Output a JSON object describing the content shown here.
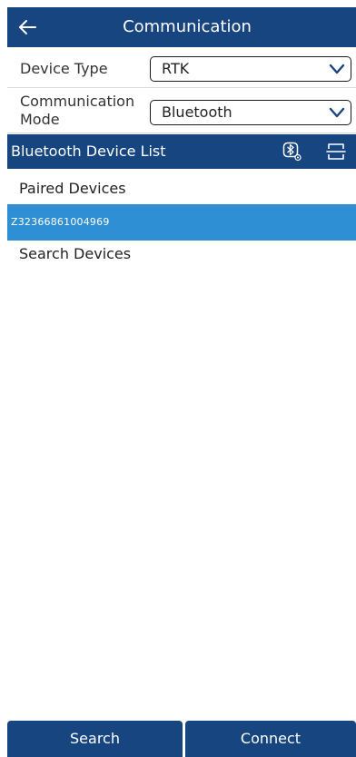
{
  "header": {
    "title": "Communication",
    "back_icon": "back-arrow-icon"
  },
  "form": {
    "device_type_label": "Device Type",
    "device_type_value": "RTK",
    "comm_mode_label": "Communication Mode",
    "comm_mode_value": "Bluetooth"
  },
  "bluetooth": {
    "section_title": "Bluetooth Device List",
    "icons": [
      "bluetooth-settings-icon",
      "scan-icon"
    ],
    "paired_label": "Paired Devices",
    "paired_devices": [
      "Z32366861004969"
    ],
    "search_label": "Search Devices"
  },
  "actions": {
    "search_label": "Search",
    "connect_label": "Connect"
  },
  "colors": {
    "primary": "#17457f",
    "selected_row": "#2f8fd4",
    "background": "#ffffff"
  }
}
